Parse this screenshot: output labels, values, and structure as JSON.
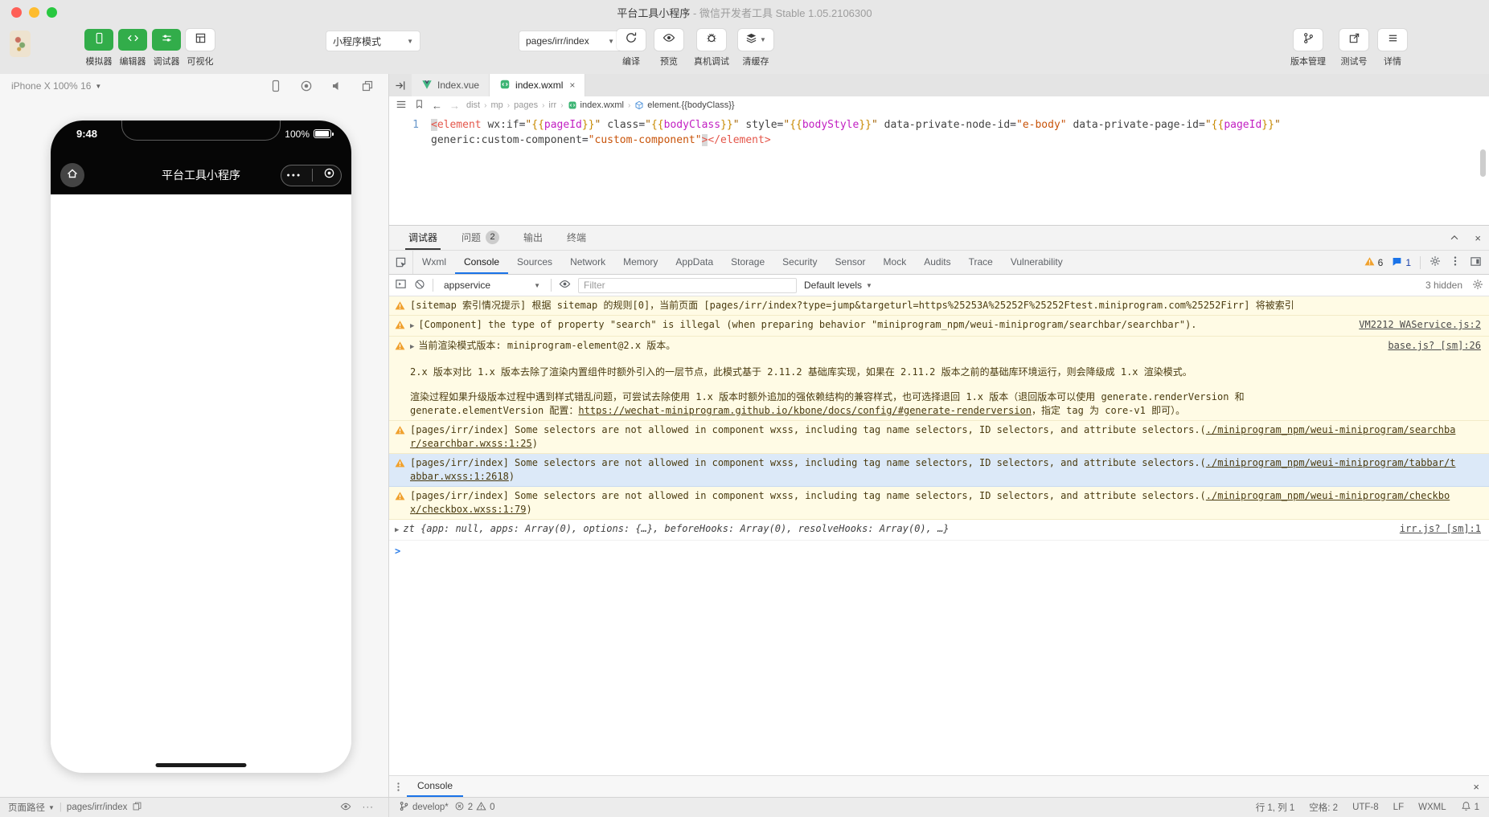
{
  "titlebar": {
    "app": "平台工具小程序",
    "sep": " - ",
    "suffix": "微信开发者工具 Stable 1.05.2106300"
  },
  "toolbar": {
    "modes": [
      {
        "label": "模拟器",
        "icon": "phone-icon",
        "active": true
      },
      {
        "label": "编辑器",
        "icon": "code-icon",
        "active": true
      },
      {
        "label": "调试器",
        "icon": "sliders-icon",
        "active": true
      },
      {
        "label": "可视化",
        "icon": "layout-icon",
        "active": false
      }
    ],
    "mode_select": "小程序模式",
    "page_select": "pages/irr/index",
    "actions": [
      {
        "label": "编译",
        "icon": "reload-icon"
      },
      {
        "label": "预览",
        "icon": "eye-icon"
      },
      {
        "label": "真机调试",
        "icon": "bug-icon"
      },
      {
        "label": "清缓存",
        "icon": "layers-icon",
        "dropdown": true
      }
    ],
    "right_actions": [
      {
        "label": "版本管理",
        "icon": "branch-icon"
      },
      {
        "label": "测试号",
        "icon": "external-link-icon"
      },
      {
        "label": "详情",
        "icon": "hamburger-icon"
      }
    ]
  },
  "simulator": {
    "device": "iPhone X 100% 16",
    "phone": {
      "time": "9:48",
      "battery": "100%",
      "title": "平台工具小程序",
      "capsule_dots": "●●●"
    }
  },
  "editor": {
    "tabs": [
      {
        "label": "Index.vue",
        "icon": "vue-icon",
        "active": false
      },
      {
        "label": "index.wxml",
        "icon": "wxml-file-icon",
        "active": true,
        "close": "×"
      }
    ],
    "breadcrumb": [
      {
        "t": "dist"
      },
      {
        "t": "mp"
      },
      {
        "t": "pages"
      },
      {
        "t": "irr"
      },
      {
        "t": "index.wxml",
        "icon": "wxml",
        "dark": true
      },
      {
        "t": "element.{{bodyClass}}",
        "icon": "element",
        "dark": true
      }
    ],
    "line_no": "1",
    "line1": [
      {
        "t": "<",
        "c": "tag bm"
      },
      {
        "t": "element",
        "c": "tag"
      },
      {
        "t": " "
      },
      {
        "t": "wx:if",
        "c": "attr"
      },
      {
        "t": "=",
        "c": "pn"
      },
      {
        "t": "\"",
        "c": "q"
      },
      {
        "t": "{{",
        "c": "br"
      },
      {
        "t": "pageId",
        "c": "var"
      },
      {
        "t": "}}",
        "c": "br"
      },
      {
        "t": "\"",
        "c": "q"
      },
      {
        "t": " "
      },
      {
        "t": "class",
        "c": "attr"
      },
      {
        "t": "=",
        "c": "pn"
      },
      {
        "t": "\"",
        "c": "q"
      },
      {
        "t": "{{",
        "c": "br"
      },
      {
        "t": "bodyClass",
        "c": "var"
      },
      {
        "t": "}}",
        "c": "br"
      },
      {
        "t": "\"",
        "c": "q"
      },
      {
        "t": " "
      },
      {
        "t": "style",
        "c": "attr"
      },
      {
        "t": "=",
        "c": "pn"
      },
      {
        "t": "\"",
        "c": "q"
      },
      {
        "t": "{{",
        "c": "br"
      },
      {
        "t": "bodyStyle",
        "c": "var"
      },
      {
        "t": "}}",
        "c": "br"
      },
      {
        "t": "\"",
        "c": "q"
      },
      {
        "t": " "
      },
      {
        "t": "data-private-node-id",
        "c": "attr"
      },
      {
        "t": "=",
        "c": "pn"
      },
      {
        "t": "\"e-body\"",
        "c": "str"
      },
      {
        "t": " "
      },
      {
        "t": "data-private-page-id",
        "c": "attr"
      },
      {
        "t": "=",
        "c": "pn"
      },
      {
        "t": "\"",
        "c": "q"
      },
      {
        "t": "{{",
        "c": "br"
      },
      {
        "t": "pageId",
        "c": "var"
      },
      {
        "t": "}}",
        "c": "br"
      },
      {
        "t": "\"",
        "c": "q"
      }
    ],
    "line2": [
      {
        "t": "generic:custom-component",
        "c": "attr"
      },
      {
        "t": "=",
        "c": "pn"
      },
      {
        "t": "\"custom-component\"",
        "c": "str"
      },
      {
        "t": ">",
        "c": "tag bm"
      },
      {
        "t": "</element>",
        "c": "tag"
      }
    ]
  },
  "debug": {
    "drawer_tabs": [
      {
        "label": "调试器",
        "active": true
      },
      {
        "label": "问题",
        "badge": "2"
      },
      {
        "label": "输出"
      },
      {
        "label": "终端"
      }
    ],
    "devtools_tabs": [
      {
        "label": "Wxml"
      },
      {
        "label": "Console",
        "active": true
      },
      {
        "label": "Sources"
      },
      {
        "label": "Network"
      },
      {
        "label": "Memory"
      },
      {
        "label": "AppData"
      },
      {
        "label": "Storage"
      },
      {
        "label": "Security"
      },
      {
        "label": "Sensor"
      },
      {
        "label": "Mock"
      },
      {
        "label": "Audits"
      },
      {
        "label": "Trace"
      },
      {
        "label": "Vulnerability"
      }
    ],
    "warn_count": "6",
    "msg_count": "1",
    "toolbar": {
      "context": "appservice",
      "filter_placeholder": "Filter",
      "levels": "Default levels",
      "hidden": "3 hidden"
    },
    "messages": [
      {
        "type": "warn",
        "text": "[sitemap 索引情况提示] 根据 sitemap 的规则[0]，当前页面 [pages/irr/index?type=jump&targeturl=https%25253A%25252F%25252Ftest.miniprogram.com%25252Firr] 将被索引"
      },
      {
        "type": "warn",
        "arrow": true,
        "text": "[Component] the type of property \"search\" is illegal (when preparing behavior \"miniprogram_npm/weui-miniprogram/searchbar/searchbar\").",
        "source": "VM2212 WAService.js:2"
      },
      {
        "type": "warn",
        "arrow": true,
        "text": "当前渲染模式版本: miniprogram-element@2.x 版本。",
        "source": "base.js? [sm]:26",
        "body": [
          "2.x 版本对比 1.x 版本去除了渲染内置组件时额外引入的一层节点，此模式基于 2.11.2 基础库实现，如果在 2.11.2 版本之前的基础库环境运行，则会降级成 1.x 渲染模式。",
          {
            "pre": "渲染过程如果升级版本过程中遇到样式错乱问题，可尝试去除使用 1.x 版本时额外追加的强依赖结构的兼容样式，也可选择退回 1.x 版本（退回版本可以使用 generate.renderVersion 和 generate.elementVersion 配置：",
            "link": "https://wechat-miniprogram.github.io/kbone/docs/config/#generate-renderversion",
            "post": "，指定 tag 为 core-v1 即可）。"
          }
        ]
      },
      {
        "type": "warn",
        "text": "[pages/irr/index] Some selectors are not allowed in component wxss, including tag name selectors, ID selectors, and attribute selectors.(",
        "link": "./miniprogram_npm/weui-miniprogram/searchbar/searchbar.wxss:1:25",
        "post": ")"
      },
      {
        "type": "warn",
        "selected": true,
        "text": "[pages/irr/index] Some selectors are not allowed in component wxss, including tag name selectors, ID selectors, and attribute selectors.(",
        "link": "./miniprogram_npm/weui-miniprogram/tabbar/tabbar.wxss:1:2618",
        "post": ")"
      },
      {
        "type": "warn",
        "text": "[pages/irr/index] Some selectors are not allowed in component wxss, including tag name selectors, ID selectors, and attribute selectors.(",
        "link": "./miniprogram_npm/weui-miniprogram/checkbox/checkbox.wxss:1:79",
        "post": ")"
      },
      {
        "type": "log",
        "arrow": true,
        "text": "zt {app: null, apps: Array(0), options: {…}, beforeHooks: Array(0), resolveHooks: Array(0), …}",
        "source": "irr.js? [sm]:1"
      },
      {
        "type": "prompt",
        "chevron": ">"
      }
    ],
    "bottom_tab": "Console",
    "drawer_close": "×"
  },
  "statusbar": {
    "page_path_label": "页面路径",
    "page_path": "pages/irr/index",
    "branch": "develop*",
    "errors": "2",
    "warnings": "0",
    "cursor": "行 1, 列 1",
    "spaces": "空格: 2",
    "encoding": "UTF-8",
    "eol": "LF",
    "lang": "WXML",
    "bell_count": "1"
  },
  "colors": {
    "accent_green": "#32ad4a",
    "tab_blue": "#1a73e8",
    "warn_bg": "#fffbe5",
    "warn_icon": "#f0a12e"
  }
}
